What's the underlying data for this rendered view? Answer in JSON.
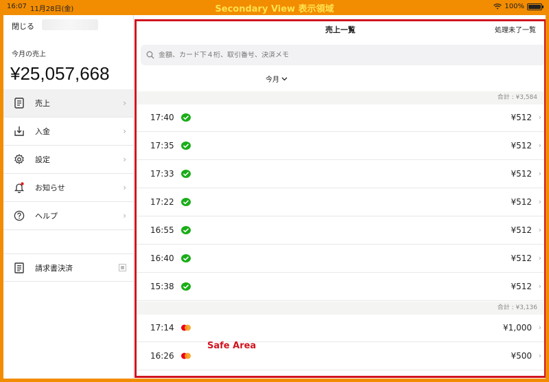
{
  "status": {
    "time": "16:07",
    "date": "11月28日(金)",
    "battery": "100%"
  },
  "overlay": {
    "secondary_view": "Secondary View 表示領域",
    "safe_area": "Safe Area"
  },
  "sidebar": {
    "close": "閉じる",
    "month_label": "今月の売上",
    "month_amount": "¥25,057,668",
    "items": [
      {
        "label": "売上",
        "icon": "receipt-icon"
      },
      {
        "label": "入金",
        "icon": "deposit-tray-icon"
      },
      {
        "label": "設定",
        "icon": "gear-icon"
      },
      {
        "label": "お知らせ",
        "icon": "bell-icon"
      },
      {
        "label": "ヘルプ",
        "icon": "question-circle-icon"
      }
    ],
    "invoice": {
      "label": "請求書決済",
      "icon": "invoice-document-icon"
    }
  },
  "main": {
    "title": "売上一覧",
    "right_action": "処理未了一覧",
    "search_placeholder": "金額、カード下４桁、取引番号、決済メモ",
    "filter": "今月",
    "groups": [
      {
        "total": "合計 : ¥3,584",
        "rows": [
          {
            "time": "17:40",
            "method": "wechat",
            "amount": "¥512"
          },
          {
            "time": "17:35",
            "method": "wechat",
            "amount": "¥512"
          },
          {
            "time": "17:33",
            "method": "wechat",
            "amount": "¥512"
          },
          {
            "time": "17:22",
            "method": "wechat",
            "amount": "¥512"
          },
          {
            "time": "16:55",
            "method": "wechat",
            "amount": "¥512"
          },
          {
            "time": "16:40",
            "method": "wechat",
            "amount": "¥512"
          },
          {
            "time": "15:38",
            "method": "wechat",
            "amount": "¥512"
          }
        ]
      },
      {
        "total": "合計 : ¥3,136",
        "rows": [
          {
            "time": "17:14",
            "method": "mastercard",
            "amount": "¥1,000"
          },
          {
            "time": "16:26",
            "method": "mastercard",
            "amount": "¥500"
          }
        ]
      }
    ]
  },
  "colors": {
    "frame": "#f28c00",
    "safe_area": "#d0141f",
    "wechat": "#1aad19",
    "mastercard_red": "#eb001b",
    "mastercard_orange": "#f79e1b"
  }
}
